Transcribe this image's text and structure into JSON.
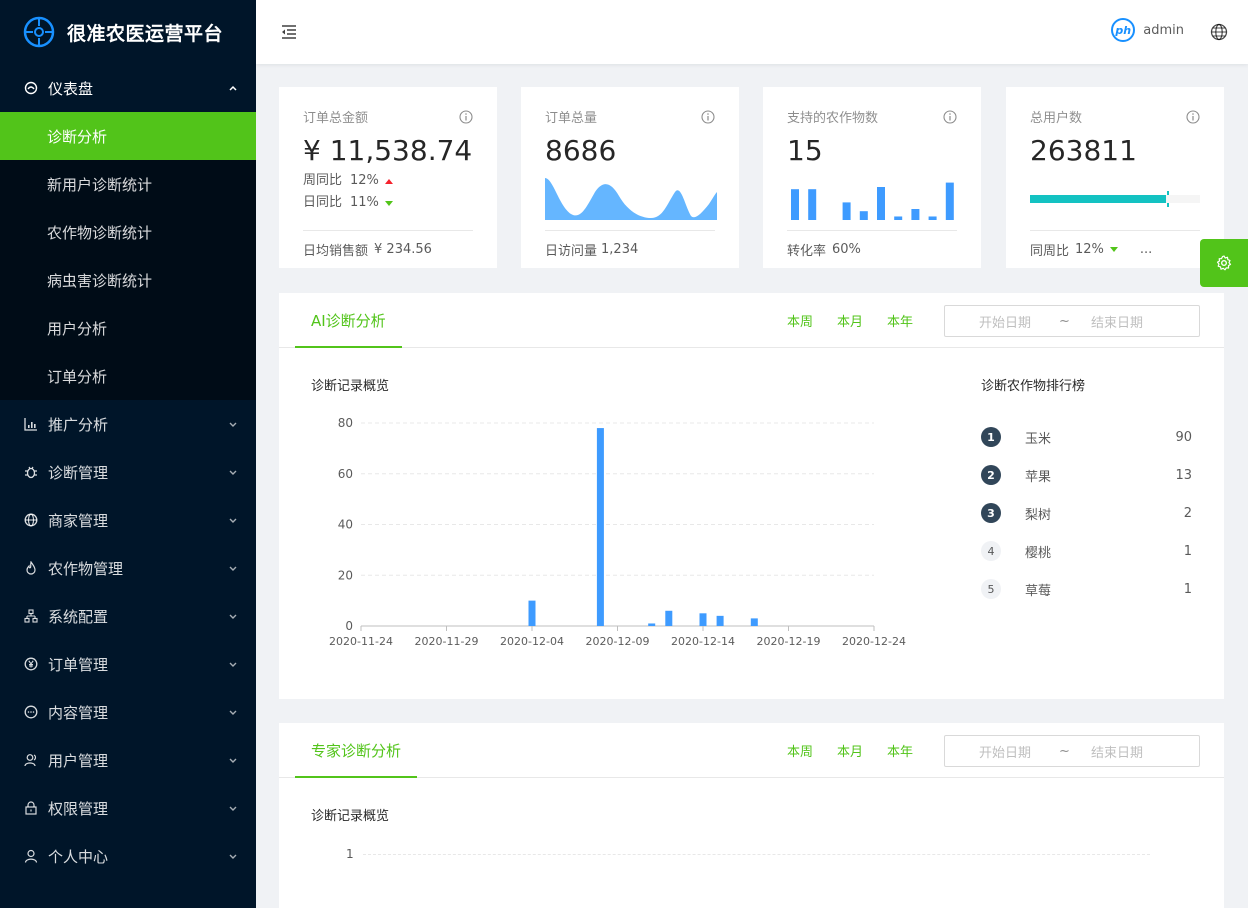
{
  "app": {
    "title": "很准农医运营平台"
  },
  "sidebar": {
    "dashboard": {
      "label": "仪表盘",
      "children": [
        {
          "label": "诊断分析",
          "active": true
        },
        {
          "label": "新用户诊断统计"
        },
        {
          "label": "农作物诊断统计"
        },
        {
          "label": "病虫害诊断统计"
        },
        {
          "label": "用户分析"
        },
        {
          "label": "订单分析"
        }
      ]
    },
    "items": [
      {
        "label": "推广分析",
        "icon": "chart-icon"
      },
      {
        "label": "诊断管理",
        "icon": "bug-icon"
      },
      {
        "label": "商家管理",
        "icon": "globe-icon"
      },
      {
        "label": "农作物管理",
        "icon": "fire-icon"
      },
      {
        "label": "系统配置",
        "icon": "cluster-icon"
      },
      {
        "label": "订单管理",
        "icon": "yuan-icon"
      },
      {
        "label": "内容管理",
        "icon": "message-icon"
      },
      {
        "label": "用户管理",
        "icon": "team-icon"
      },
      {
        "label": "权限管理",
        "icon": "lock-icon"
      },
      {
        "label": "个人中心",
        "icon": "user-icon"
      }
    ]
  },
  "header": {
    "avatar_text": "ph",
    "username": "admin"
  },
  "cards": {
    "sales": {
      "title": "订单总金额",
      "value": "¥ 11,538.74",
      "week_label": "周同比",
      "week_value": "12%",
      "day_label": "日同比",
      "day_value": "11%",
      "footer_label": "日均销售额",
      "footer_value": "¥ 234.56"
    },
    "orders": {
      "title": "订单总量",
      "value": "8686",
      "footer_label": "日访问量",
      "footer_value": "1,234"
    },
    "crops": {
      "title": "支持的农作物数",
      "value": "15",
      "footer_label": "转化率",
      "footer_value": "60%",
      "bar_values": [
        7,
        7,
        0,
        4,
        2,
        7.5,
        0.8,
        2.5,
        0.8,
        8.5
      ]
    },
    "users": {
      "title": "总用户数",
      "value": "263811",
      "progress_percent": 80,
      "target_percent": 80,
      "footer_label": "同周比",
      "footer_value": "12%",
      "footer_more": "..."
    }
  },
  "panel_ai": {
    "tab": "AI诊断分析",
    "ranges": [
      "本周",
      "本月",
      "本年"
    ],
    "start_placeholder": "开始日期",
    "separator": "~",
    "end_placeholder": "结束日期",
    "chart_title": "诊断记录概览",
    "rank_title": "诊断农作物排行榜",
    "rank": [
      {
        "no": "1",
        "name": "玉米",
        "value": "90"
      },
      {
        "no": "2",
        "name": "苹果",
        "value": "13"
      },
      {
        "no": "3",
        "name": "梨树",
        "value": "2"
      },
      {
        "no": "4",
        "name": "樱桃",
        "value": "1"
      },
      {
        "no": "5",
        "name": "草莓",
        "value": "1"
      }
    ]
  },
  "panel_expert": {
    "tab": "专家诊断分析",
    "ranges": [
      "本周",
      "本月",
      "本年"
    ],
    "start_placeholder": "开始日期",
    "separator": "~",
    "end_placeholder": "结束日期",
    "chart_title": "诊断记录概览",
    "ytick": "1"
  },
  "chart_data": {
    "type": "bar",
    "x_ticks": [
      "2020-11-24",
      "2020-11-29",
      "2020-12-04",
      "2020-12-09",
      "2020-12-14",
      "2020-12-19",
      "2020-12-24"
    ],
    "y_ticks": [
      0,
      20,
      40,
      60,
      80
    ],
    "ylim": [
      0,
      80
    ],
    "x_start": "2020-11-24",
    "points": [
      {
        "x": "2020-12-04",
        "y": 10
      },
      {
        "x": "2020-12-08",
        "y": 78
      },
      {
        "x": "2020-12-11",
        "y": 1
      },
      {
        "x": "2020-12-12",
        "y": 6
      },
      {
        "x": "2020-12-14",
        "y": 5
      },
      {
        "x": "2020-12-15",
        "y": 4
      },
      {
        "x": "2020-12-17",
        "y": 3
      }
    ],
    "color": "#3e9bff"
  }
}
